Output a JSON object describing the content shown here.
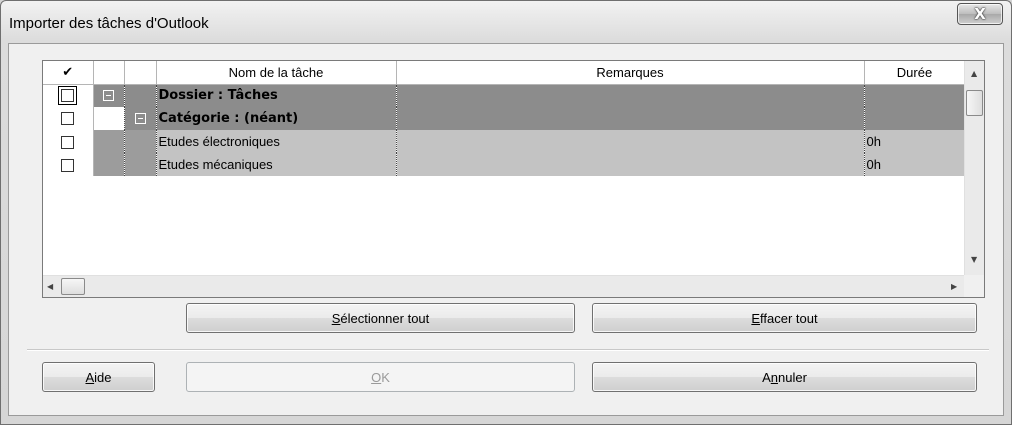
{
  "window": {
    "title": "Importer des tâches d'Outlook",
    "close_glyph": "X"
  },
  "grid": {
    "columns": {
      "check": "✔",
      "name": "Nom de la tâche",
      "remarks": "Remarques",
      "duration": "Durée"
    },
    "rows": [
      {
        "kind": "folder",
        "name": "Dossier : Tâches",
        "remarks": "",
        "duration": ""
      },
      {
        "kind": "category",
        "name": "Catégorie : (néant)",
        "remarks": "",
        "duration": ""
      },
      {
        "kind": "task",
        "name": "Etudes électroniques",
        "remarks": "",
        "duration": "0h"
      },
      {
        "kind": "task",
        "name": "Etudes mécaniques",
        "remarks": "",
        "duration": "0h"
      }
    ],
    "scroll_arrows": {
      "up": "▲",
      "down": "▼",
      "left": "◀",
      "right": "▶"
    }
  },
  "buttons": {
    "select_all": {
      "key": "S",
      "rest": "électionner tout"
    },
    "clear_all": {
      "key": "E",
      "rest": "ffacer tout"
    },
    "help": {
      "key": "A",
      "rest": "ide"
    },
    "ok": {
      "key": "O",
      "rest": "K"
    },
    "cancel": {
      "pre": "A",
      "key": "n",
      "rest": "nuler"
    }
  },
  "colors": {
    "folder_row": "#8c8c8c",
    "task_row": "#c3c3c3"
  }
}
